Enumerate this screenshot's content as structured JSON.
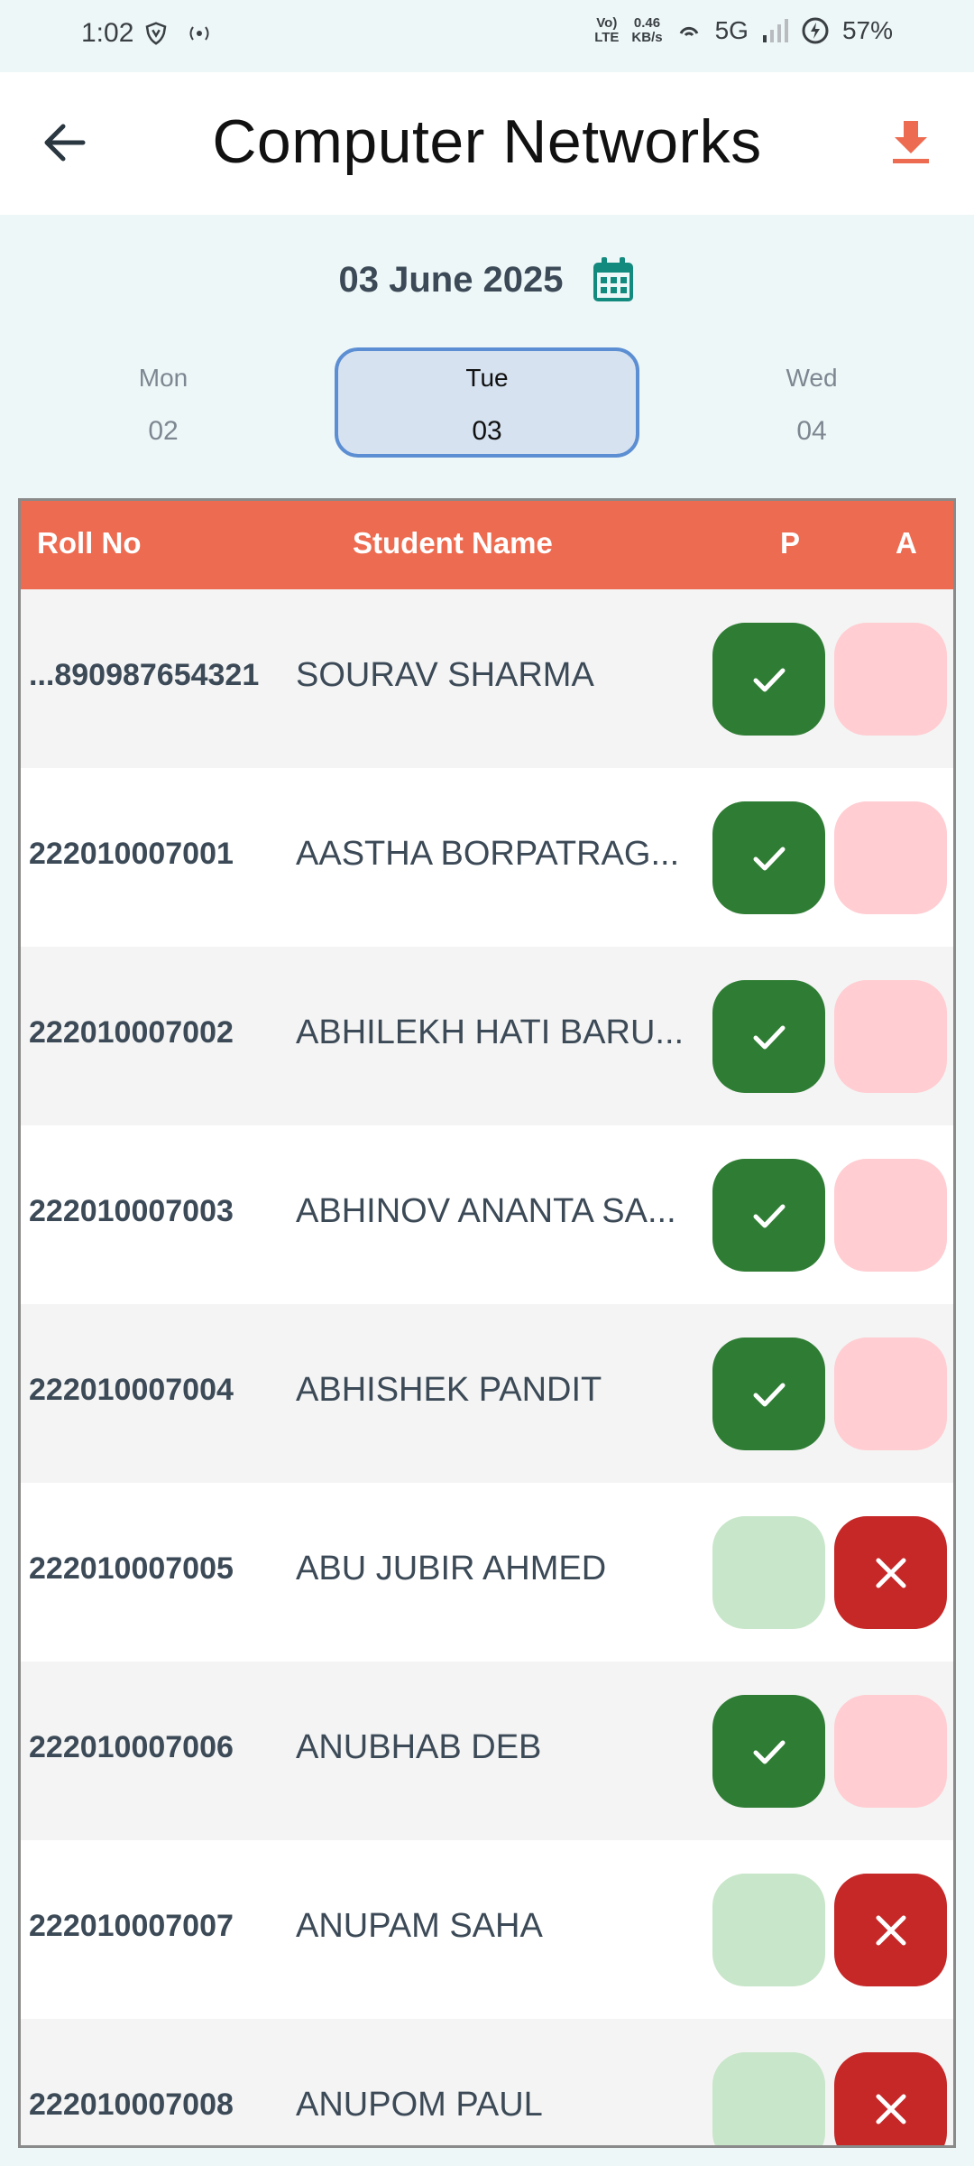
{
  "status_bar": {
    "time": "1:02",
    "network_label": "Vo) LTE",
    "speed_value": "0.46",
    "speed_unit": "KB/s",
    "network_type": "5G",
    "battery": "57%"
  },
  "header": {
    "title": "Computer Networks",
    "back_icon": "arrow-left-icon",
    "download_icon": "download-icon",
    "accent_color": "#ed6b50"
  },
  "date_picker": {
    "date": "03 June 2025",
    "calendar_icon": "calendar-icon"
  },
  "days": [
    {
      "name": "Mon",
      "num": "02",
      "selected": false
    },
    {
      "name": "Tue",
      "num": "03",
      "selected": true
    },
    {
      "name": "Wed",
      "num": "04",
      "selected": false
    }
  ],
  "table": {
    "headers": {
      "roll": "Roll No",
      "name": "Student Name",
      "present": "P",
      "absent": "A"
    },
    "rows": [
      {
        "roll": "...890987654321",
        "name": "SOURAV SHARMA",
        "status": "present"
      },
      {
        "roll": "222010007001",
        "name": "AASTHA BORPATRAG...",
        "status": "present"
      },
      {
        "roll": "222010007002",
        "name": "ABHILEKH HATI BARU...",
        "status": "present"
      },
      {
        "roll": "222010007003",
        "name": "ABHINOV ANANTA SA...",
        "status": "present"
      },
      {
        "roll": "222010007004",
        "name": "ABHISHEK PANDIT",
        "status": "present"
      },
      {
        "roll": "222010007005",
        "name": "ABU JUBIR AHMED",
        "status": "absent"
      },
      {
        "roll": "222010007006",
        "name": "ANUBHAB DEB",
        "status": "present"
      },
      {
        "roll": "222010007007",
        "name": "ANUPAM SAHA",
        "status": "absent"
      },
      {
        "roll": "222010007008",
        "name": "ANUPOM PAUL",
        "status": "absent"
      }
    ]
  }
}
